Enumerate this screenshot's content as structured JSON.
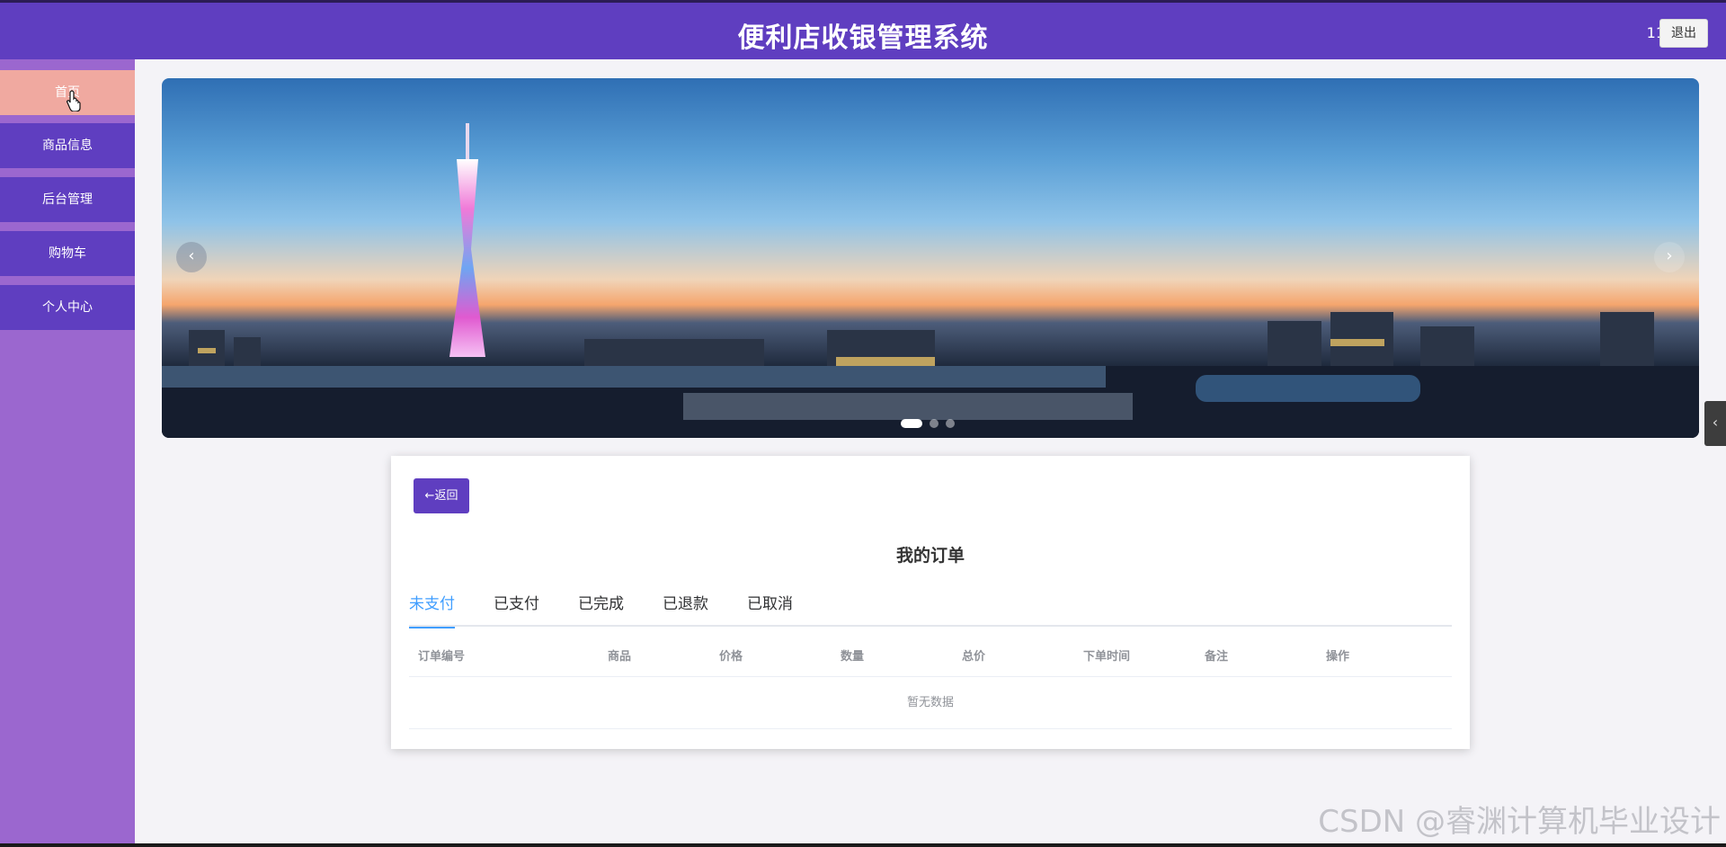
{
  "header": {
    "title": "便利店收银管理系统",
    "username": "11",
    "logout_label": "退出"
  },
  "sidebar": {
    "items": [
      {
        "label": "首页",
        "active": true
      },
      {
        "label": "商品信息"
      },
      {
        "label": "后台管理"
      },
      {
        "label": "购物车"
      },
      {
        "label": "个人中心"
      }
    ]
  },
  "carousel": {
    "prev_label": "‹",
    "next_label": "›",
    "slide_count": 3,
    "active_slide": 1
  },
  "orders": {
    "back_label": "←返回",
    "title": "我的订单",
    "tabs": [
      {
        "label": "未支付",
        "active": true
      },
      {
        "label": "已支付"
      },
      {
        "label": "已完成"
      },
      {
        "label": "已退款"
      },
      {
        "label": "已取消"
      }
    ],
    "columns": [
      "订单编号",
      "商品",
      "价格",
      "数量",
      "总价",
      "下单时间",
      "备注",
      "操作"
    ],
    "empty_text": "暂无数据"
  },
  "side_tab_label": "‹",
  "watermark": "CSDN @睿渊计算机毕业设计",
  "colors": {
    "primary": "#5f3ec0",
    "sidebar_bg": "#9b67cf",
    "active_nav": "#f0a9a0",
    "tab_active": "#409eff"
  }
}
